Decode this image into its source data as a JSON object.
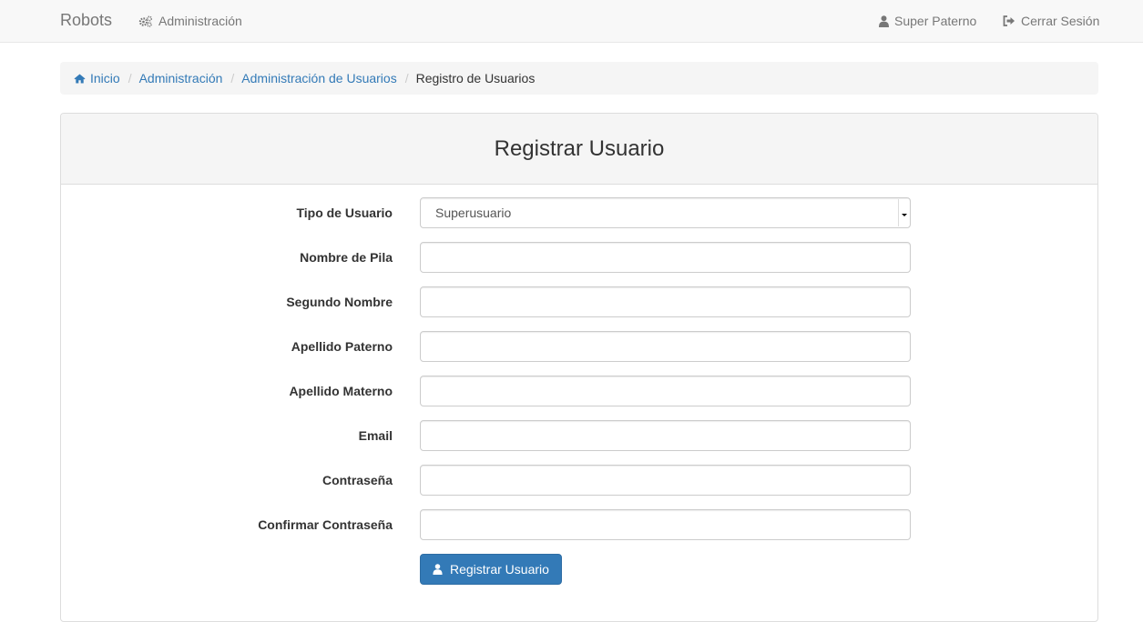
{
  "navbar": {
    "brand": "Robots",
    "admin_label": "Administración",
    "user_label": "Super Paterno",
    "logout_label": "Cerrar Sesión"
  },
  "breadcrumb": {
    "home": "Inicio",
    "admin": "Administración",
    "users_admin": "Administración de Usuarios",
    "current": "Registro de Usuarios",
    "separator": "/"
  },
  "panel": {
    "title": "Registrar Usuario"
  },
  "form": {
    "tipo_label": "Tipo de Usuario",
    "tipo_value": "Superusuario",
    "nombre_label": "Nombre de Pila",
    "nombre_value": "",
    "segundo_label": "Segundo Nombre",
    "segundo_value": "",
    "paterno_label": "Apellido Paterno",
    "paterno_value": "",
    "materno_label": "Apellido Materno",
    "materno_value": "",
    "email_label": "Email",
    "email_value": "",
    "password_label": "Contraseña",
    "password_value": "",
    "confirm_label": "Confirmar Contraseña",
    "confirm_value": "",
    "submit_label": "Registrar Usuario"
  },
  "colors": {
    "link": "#337ab7",
    "primary_button": "#337ab7"
  }
}
